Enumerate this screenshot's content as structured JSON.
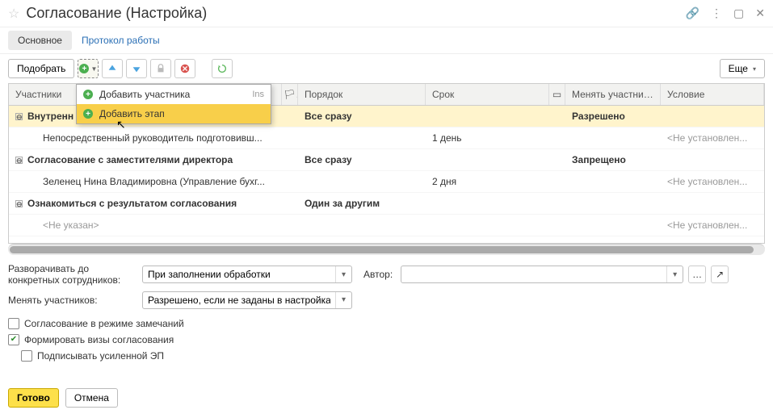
{
  "title": "Согласование (Настройка)",
  "tabs": {
    "main": "Основное",
    "protocol": "Протокол работы"
  },
  "toolbar": {
    "select": "Подобрать",
    "more": "Еще"
  },
  "dropdown": {
    "add_participant": "Добавить участника",
    "add_participant_shortcut": "Ins",
    "add_stage": "Добавить этап"
  },
  "columns": {
    "participants": "Участники",
    "order": "Порядок",
    "deadline": "Срок",
    "change_participants": "Менять участнико...",
    "condition": "Условие"
  },
  "rows": [
    {
      "type": "stage",
      "selected": true,
      "expander": "⊖",
      "name": "Внутренн",
      "order": "Все сразу",
      "deadline": "",
      "change": "Разрешено",
      "cond": ""
    },
    {
      "type": "child",
      "name": "Непосредственный руководитель подготовивш...",
      "order": "",
      "deadline": "1 день",
      "change": "",
      "cond": "<Не установлен..."
    },
    {
      "type": "stage",
      "expander": "⊖",
      "name": "Согласование с заместителями директора",
      "order": "Все сразу",
      "deadline": "",
      "change": "Запрещено",
      "cond": ""
    },
    {
      "type": "child",
      "name": "Зеленец Нина Владимировна (Управление бухг...",
      "order": "",
      "deadline": "2 дня",
      "change": "",
      "cond": "<Не установлен..."
    },
    {
      "type": "stage",
      "expander": "⊖",
      "name": "Ознакомиться с результатом согласования",
      "order": "Один за другим",
      "deadline": "",
      "change": "",
      "cond": ""
    },
    {
      "type": "child",
      "name": "<Не указан>",
      "order": "",
      "deadline": "",
      "change": "",
      "cond": "<Не установлен..."
    }
  ],
  "form": {
    "expand_label": "Разворачивать до конкретных сотрудников:",
    "expand_value": "При заполнении обработки",
    "author_label": "Автор:",
    "author_value": "",
    "change_label": "Менять участников:",
    "change_value": "Разрешено, если не заданы в настройках"
  },
  "checks": {
    "remarks": "Согласование в режиме замечаний",
    "visas": "Формировать визы согласования",
    "sign": "Подписывать усиленной ЭП"
  },
  "footer": {
    "done": "Готово",
    "cancel": "Отмена"
  }
}
